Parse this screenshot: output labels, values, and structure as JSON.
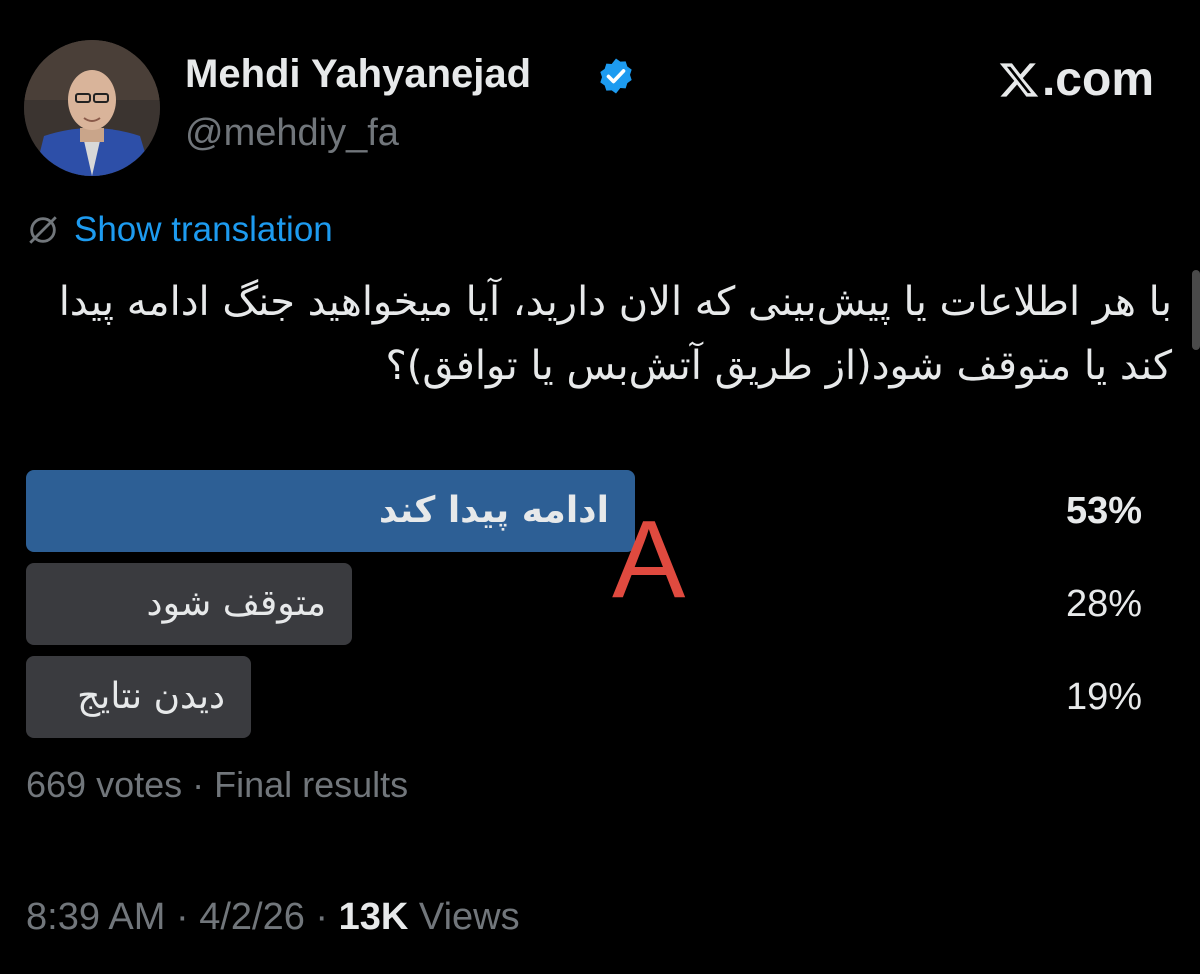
{
  "author": {
    "name": "Mehdi Yahyanejad",
    "handle": "@mehdiy_fa",
    "verified_icon": "verified-badge-icon"
  },
  "brand": {
    "site": ".com",
    "logo_icon": "x-logo-icon"
  },
  "translation": {
    "label": "Show translation",
    "icon": "translate-globe-icon"
  },
  "tweet": {
    "text": "با هر اطلاعات یا پیش‌بینی که الان دارید، آیا میخواهید جنگ ادامه پیدا کند یا متوقف شود(از طریق آتش‌بس یا توافق)؟"
  },
  "poll": {
    "options": [
      {
        "label": "ادامه پیدا کند",
        "percent": "53%",
        "fraction": 0.53,
        "winner": true
      },
      {
        "label": "متوقف شود",
        "percent": "28%",
        "fraction": 0.28,
        "winner": false
      },
      {
        "label": "دیدن نتایج",
        "percent": "19%",
        "fraction": 0.19,
        "winner": false
      }
    ],
    "summary": "669 votes · Final results"
  },
  "annotation": {
    "label": "A",
    "color": "#e04a3f"
  },
  "meta": {
    "time": "8:39 AM",
    "date": "4/2/26",
    "views_count": "13K",
    "views_label": "Views"
  },
  "colors": {
    "background": "#000000",
    "text_primary": "#e7e9ea",
    "text_secondary": "#71767b",
    "link": "#1d9bf0",
    "poll_winner": "#2d5f95",
    "poll_other": "#3a3b3f",
    "verified": "#1d9bf0"
  }
}
